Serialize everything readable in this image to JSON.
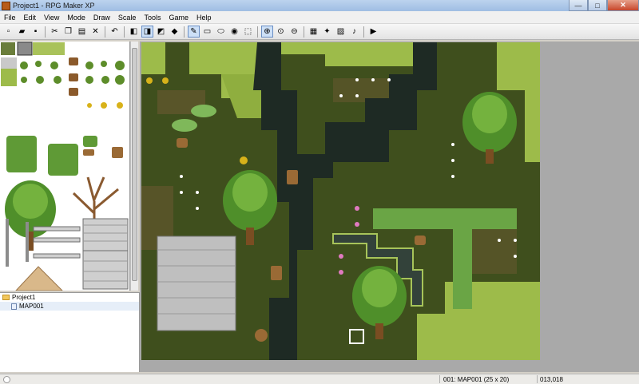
{
  "window": {
    "title": "Project1 - RPG Maker XP",
    "minimize": "—",
    "maximize": "□",
    "close": "✕"
  },
  "menu": [
    "File",
    "Edit",
    "View",
    "Mode",
    "Draw",
    "Scale",
    "Tools",
    "Game",
    "Help"
  ],
  "toolbar": [
    {
      "name": "new-project-icon",
      "glyph": "▫"
    },
    {
      "name": "open-project-icon",
      "glyph": "▰"
    },
    {
      "name": "save-project-icon",
      "glyph": "▪"
    },
    {
      "sep": true
    },
    {
      "name": "cut-icon",
      "glyph": "✂"
    },
    {
      "name": "copy-icon",
      "glyph": "❐"
    },
    {
      "name": "paste-icon",
      "glyph": "▤"
    },
    {
      "name": "delete-icon",
      "glyph": "✕"
    },
    {
      "sep": true
    },
    {
      "name": "undo-icon",
      "glyph": "↶"
    },
    {
      "sep": true
    },
    {
      "name": "layer-1-icon",
      "glyph": "◧"
    },
    {
      "name": "layer-2-icon",
      "glyph": "◨",
      "active": true
    },
    {
      "name": "layer-3-icon",
      "glyph": "◩"
    },
    {
      "name": "events-layer-icon",
      "glyph": "◆"
    },
    {
      "sep": true
    },
    {
      "name": "pencil-icon",
      "glyph": "✎",
      "active": true
    },
    {
      "name": "rectangle-icon",
      "glyph": "▭"
    },
    {
      "name": "ellipse-icon",
      "glyph": "⬭"
    },
    {
      "name": "fill-icon",
      "glyph": "◉"
    },
    {
      "name": "select-icon",
      "glyph": "⬚"
    },
    {
      "sep": true
    },
    {
      "name": "zoom-1x-icon",
      "glyph": "⊕",
      "active": true
    },
    {
      "name": "zoom-half-icon",
      "glyph": "⊙"
    },
    {
      "name": "zoom-quarter-icon",
      "glyph": "⊖"
    },
    {
      "sep": true
    },
    {
      "name": "database-icon",
      "glyph": "▦"
    },
    {
      "name": "materialbase-icon",
      "glyph": "✦"
    },
    {
      "name": "script-editor-icon",
      "glyph": "▨"
    },
    {
      "name": "sound-test-icon",
      "glyph": "♪"
    },
    {
      "sep": true
    },
    {
      "name": "playtest-icon",
      "glyph": "▶"
    }
  ],
  "tree": {
    "project": "Project1",
    "maps": [
      "MAP001"
    ]
  },
  "status": {
    "map": "001: MAP001 (25 x 20)",
    "coords": "013,018"
  },
  "colors": {
    "grass_dark": "#3f4f1d",
    "grass_light": "#9dbb4a",
    "water": "#1e2a24",
    "dirt": "#6b5a32"
  }
}
